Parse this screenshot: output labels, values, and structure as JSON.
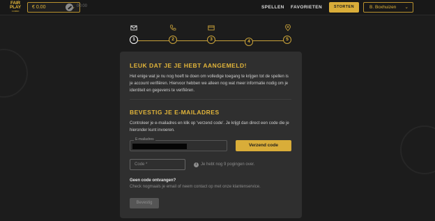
{
  "header": {
    "logo_line1": "FAIR",
    "logo_line2": "PLAY",
    "logo_sub": "CASINO",
    "balance": "€ 0.00",
    "bonus_value": "00:00",
    "nav_spellen": "SPELLEN",
    "nav_favorieten": "FAVORIETEN",
    "storten_label": "STORTEN",
    "user_name": "B. Boxhuizen"
  },
  "stepper": {
    "steps": [
      "1",
      "2",
      "3",
      "4",
      "5"
    ],
    "active_step": 1,
    "icons": [
      "mail-icon",
      "phone-icon",
      "card-icon",
      "",
      "location-icon"
    ]
  },
  "card": {
    "title1": "Leuk dat je je hebt aangemeld!",
    "intro": "Het enige wat je nu nog hoeft te doen om volledige toegang te krijgen tot de spellen is je account verifiëren. Hiervoor hebben we alleen nog wat meer informatie nodig om je identiteit en gegevens te verifiëren.",
    "title2": "Bevestig je e-mailadres",
    "instruction": "Controleer je e-mailadres en klik op 'verzend code'. Je krijgt dan direct een code die je hieronder kunt invoeren.",
    "email_label": "E-mailadres",
    "send_code_label": "Verzend code",
    "code_placeholder": "Code *",
    "attempts_text": "Je hebt nog 9 pogingen over.",
    "no_code_title": "Geen code ontvangen?",
    "no_code_text": "Check nogmaals je email of neem contact op met onze klantenservice.",
    "confirm_label": "Bevestig"
  },
  "colors": {
    "accent": "#d9ad39",
    "background": "#1c1c1c",
    "card": "#2f2f2f"
  }
}
